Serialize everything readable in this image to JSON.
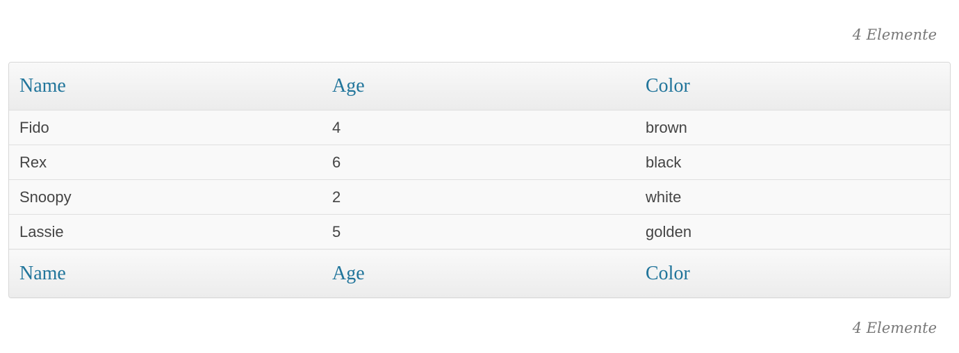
{
  "item_count_label": "4 Elemente",
  "table": {
    "columns": [
      "Name",
      "Age",
      "Color"
    ],
    "rows": [
      {
        "name": "Fido",
        "age": "4",
        "color": "brown"
      },
      {
        "name": "Rex",
        "age": "6",
        "color": "black"
      },
      {
        "name": "Snoopy",
        "age": "2",
        "color": "white"
      },
      {
        "name": "Lassie",
        "age": "5",
        "color": "golden"
      }
    ]
  },
  "colors": {
    "header_link": "#21759b",
    "body_text": "#444444",
    "count_text": "#777777",
    "border": "#dfdfdf"
  }
}
